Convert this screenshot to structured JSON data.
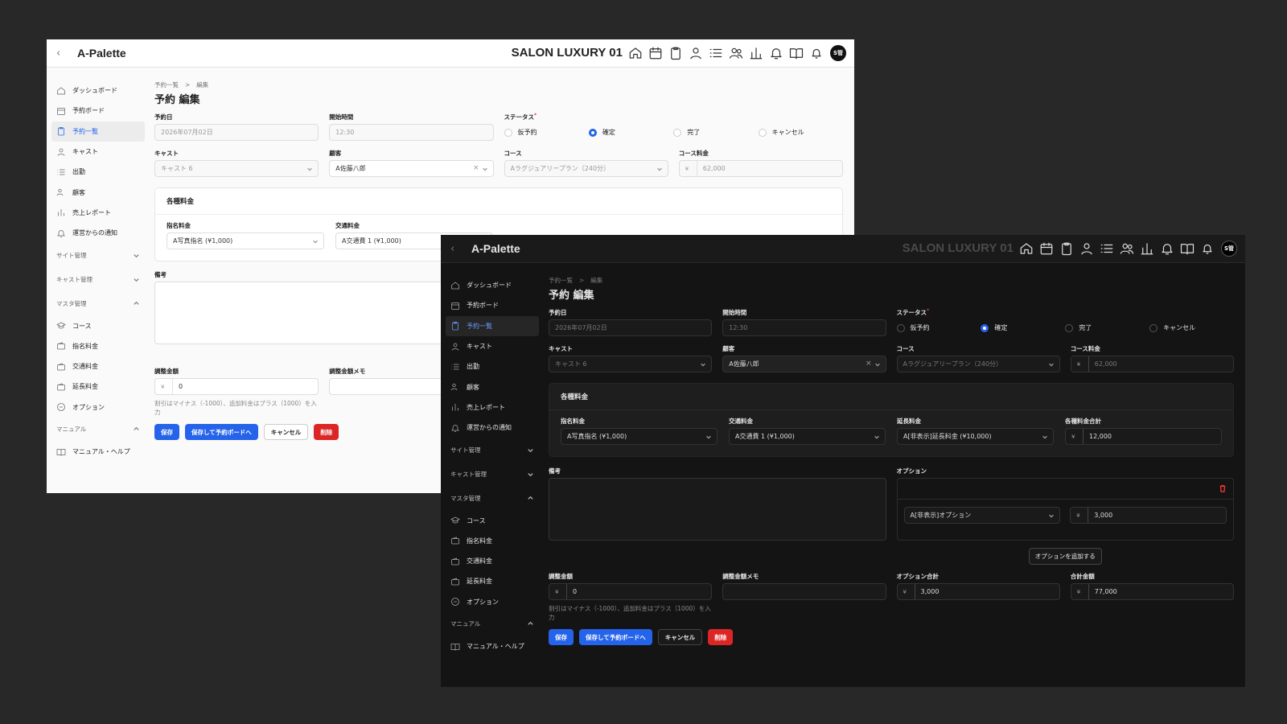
{
  "app": {
    "logo": "A-Palette",
    "salon": "SALON LUXURY 01",
    "avatar": "S管",
    "back": "‹"
  },
  "sidebar": {
    "top_items": [
      {
        "label": "ダッシュボード",
        "icon": "home-icon"
      },
      {
        "label": "予約ボード",
        "icon": "calendar-icon"
      },
      {
        "label": "予約一覧",
        "icon": "clipboard-icon",
        "active": true
      },
      {
        "label": "キャスト",
        "icon": "user-icon"
      },
      {
        "label": "出勤",
        "icon": "list-icon"
      },
      {
        "label": "顧客",
        "icon": "users-icon"
      },
      {
        "label": "売上レポート",
        "icon": "bar-chart-icon"
      },
      {
        "label": "運営からの通知",
        "icon": "bell-icon"
      }
    ],
    "sections": {
      "site": "サイト管理",
      "cast": "キャスト管理",
      "master": "マスタ管理",
      "manual": "マニュアル"
    },
    "master_items": [
      {
        "label": "コース",
        "icon": "course-icon"
      },
      {
        "label": "指名料金",
        "icon": "wallet-icon"
      },
      {
        "label": "交通料金",
        "icon": "wallet-icon"
      },
      {
        "label": "延長料金",
        "icon": "wallet-icon"
      },
      {
        "label": "オプション",
        "icon": "circle-minus-icon"
      }
    ],
    "manual_items": [
      {
        "label": "マニュアル・ヘルプ",
        "icon": "book-icon"
      }
    ]
  },
  "breadcrumb": {
    "parent": "予約一覧",
    "sep": ">",
    "current": "編集"
  },
  "page_title": "予約 編集",
  "form": {
    "date": {
      "label": "予約日",
      "value": "2026年07月02日"
    },
    "time": {
      "label": "開始時間",
      "value": "12:30"
    },
    "status": {
      "label": "ステータス",
      "req": "*",
      "options": [
        "仮予約",
        "確定",
        "完了",
        "キャンセル"
      ],
      "selected": "確定"
    },
    "cast": {
      "label": "キャスト",
      "value": "キャスト 6"
    },
    "customer": {
      "label": "顧客",
      "value": "A佐藤八郎",
      "clear": "×"
    },
    "course": {
      "label": "コース",
      "value": "Aラグジュアリープラン（240分）"
    },
    "course_fee": {
      "label": "コース料金",
      "value": "62,000"
    },
    "currency": "¥"
  },
  "fees": {
    "title": "各種料金",
    "nomination": {
      "label": "指名料金",
      "value": "A写真指名 (¥1,000)"
    },
    "transport": {
      "label": "交通料金",
      "value": "A交通費 1 (¥1,000)"
    },
    "extension": {
      "label": "延長料金",
      "value": "A[非表示]延長料金 (¥10,000)"
    },
    "total": {
      "label": "各種料金合計",
      "value": "12,000"
    }
  },
  "notes": {
    "label": "備考"
  },
  "options": {
    "label": "オプション",
    "item": "A[非表示]オプション",
    "price": "3,000",
    "add_label": "オプションを追加する"
  },
  "adjust": {
    "label": "調整金額",
    "value": "0",
    "hint": "割引はマイナス（-1000）、追加料金はプラス（1000）を入力"
  },
  "adjust_memo": {
    "label": "調整金額メモ",
    "value": ""
  },
  "option_total": {
    "label": "オプション合計",
    "value": "3,000"
  },
  "grand_total": {
    "label": "合計金額",
    "value": "77,000"
  },
  "buttons": {
    "save": "保存",
    "save_board": "保存して予約ボードへ",
    "cancel": "キャンセル",
    "delete": "削除"
  },
  "colors": {
    "accent": "#2563eb",
    "danger": "#dc2626",
    "backdrop": "#282828"
  }
}
